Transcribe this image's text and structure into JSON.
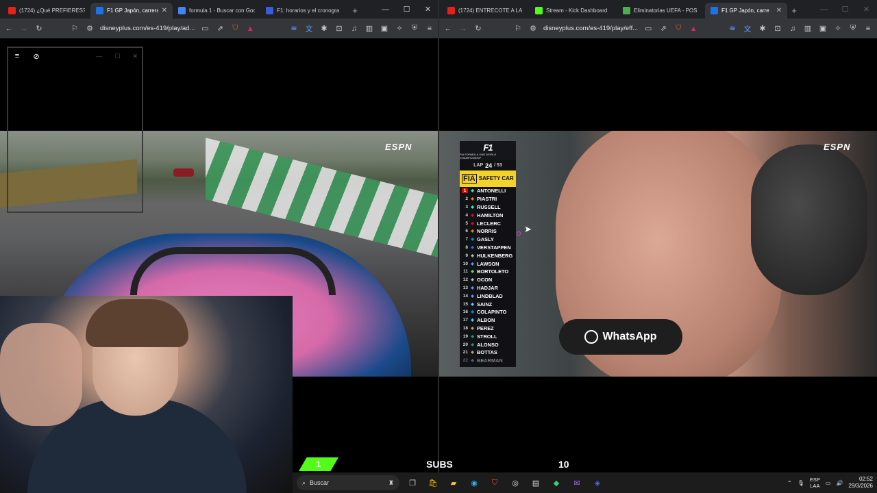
{
  "left_browser": {
    "tabs": [
      {
        "title": "(1724) ¿Qué PREFIERES? 🎯",
        "icon": "youtube-icon",
        "color": "#e62117",
        "active": false
      },
      {
        "title": "F1 GP Japón, carrera",
        "icon": "disney-icon",
        "color": "#1a73e8",
        "active": true
      },
      {
        "title": "formula 1 - Buscar con Goo",
        "icon": "google-icon",
        "color": "#4285f4",
        "active": false
      },
      {
        "title": "F1: horarios y el cronogra",
        "icon": "tudn-icon",
        "color": "#3b5bdb",
        "active": false
      }
    ],
    "url": "disneyplus.com/es-419/play/ad..."
  },
  "right_browser": {
    "tabs": [
      {
        "title": "(1724) ENTRECOTE A LA",
        "icon": "youtube-icon",
        "color": "#e62117",
        "active": false
      },
      {
        "title": "Stream - Kick Dashboard",
        "icon": "kick-icon",
        "color": "#53fc18",
        "active": false
      },
      {
        "title": "Eliminatorias UEFA - POS",
        "icon": "uefa-icon",
        "color": "#4caf50",
        "active": false
      },
      {
        "title": "F1 GP Japón, carre",
        "icon": "disney-icon",
        "color": "#1a73e8",
        "active": true
      }
    ],
    "url": "disneyplus.com/es-419/play/eff..."
  },
  "video": {
    "broadcaster": "ESPN",
    "lap_label": "LAP",
    "lap_current": "24",
    "lap_total": "/ 53",
    "safety_car_badge": "FIA",
    "safety_car_text": "SAFETY CAR",
    "f1_logo": "F1",
    "f1_sub": "FIA FORMULA ONE WORLD CHAMPIONSHIP",
    "standings": [
      {
        "pos": "1",
        "driver": "ANTONELLI"
      },
      {
        "pos": "2",
        "driver": "PIASTRI"
      },
      {
        "pos": "3",
        "driver": "RUSSELL"
      },
      {
        "pos": "4",
        "driver": "HAMILTON"
      },
      {
        "pos": "5",
        "driver": "LECLERC"
      },
      {
        "pos": "6",
        "driver": "NORRIS"
      },
      {
        "pos": "7",
        "driver": "GASLY"
      },
      {
        "pos": "8",
        "driver": "VERSTAPPEN"
      },
      {
        "pos": "9",
        "driver": "HULKENBERG"
      },
      {
        "pos": "10",
        "driver": "LAWSON"
      },
      {
        "pos": "11",
        "driver": "BORTOLETO"
      },
      {
        "pos": "12",
        "driver": "OCON"
      },
      {
        "pos": "13",
        "driver": "HADJAR"
      },
      {
        "pos": "14",
        "driver": "LINDBLAD"
      },
      {
        "pos": "15",
        "driver": "SAINZ"
      },
      {
        "pos": "16",
        "driver": "COLAPINTO"
      },
      {
        "pos": "17",
        "driver": "ALBON"
      },
      {
        "pos": "18",
        "driver": "PEREZ"
      },
      {
        "pos": "19",
        "driver": "STROLL"
      },
      {
        "pos": "20",
        "driver": "ALONSO"
      },
      {
        "pos": "21",
        "driver": "BOTTAS"
      },
      {
        "pos": "22",
        "driver": "BEARMAN"
      }
    ],
    "mic_brand": "WhatsApp"
  },
  "stream_overlay": {
    "current_subs": "1",
    "label": "SUBS",
    "goal": "10",
    "accent": "#53fc18"
  },
  "taskbar": {
    "search_placeholder": "Buscar",
    "language_top": "ESP",
    "language_bottom": "LAA",
    "time": "02:52",
    "date": "29/3/2026"
  }
}
